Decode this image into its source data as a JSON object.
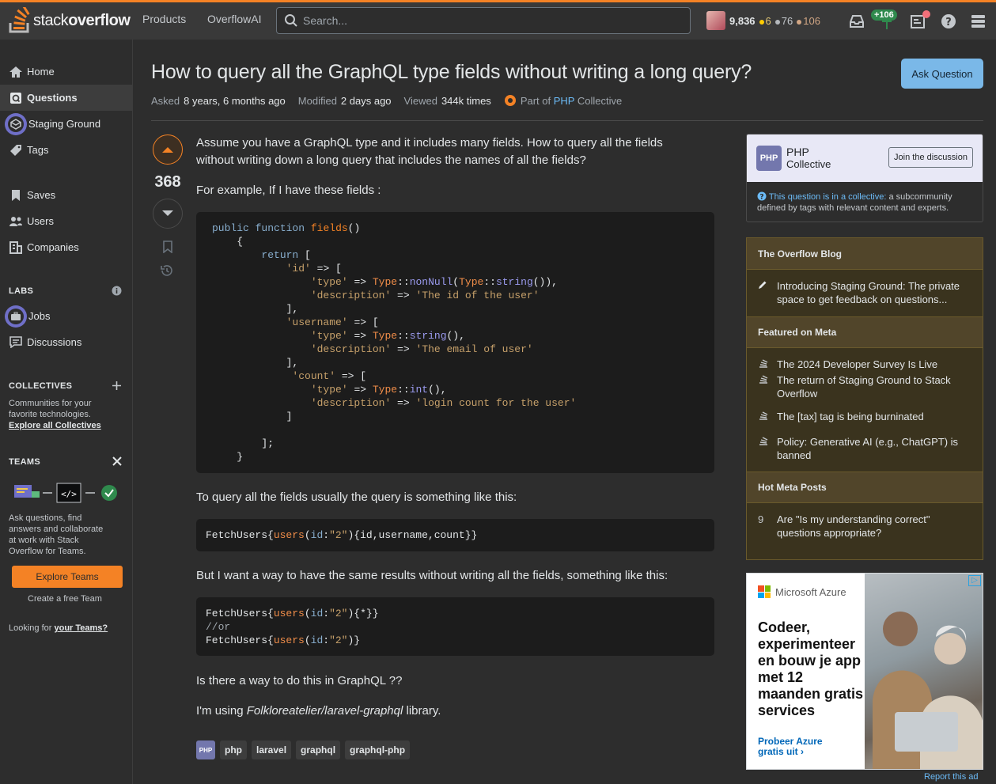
{
  "topbar": {
    "logo_light": "stack",
    "logo_bold": "overflow",
    "nav": [
      "Products",
      "OverflowAI"
    ],
    "search_placeholder": "Search...",
    "reputation": "9,836",
    "gold": "6",
    "silver": "76",
    "bronze": "106",
    "achievement": "+106"
  },
  "sidebar": {
    "items": [
      "Home",
      "Questions",
      "Staging Ground",
      "Tags",
      "Saves",
      "Users",
      "Companies"
    ],
    "labs_heading": "LABS",
    "labs_items": [
      "Jobs",
      "Discussions"
    ],
    "collectives_heading": "COLLECTIVES",
    "collectives_desc_1": "Communities for your",
    "collectives_desc_2": "favorite technologies.",
    "collectives_link": "Explore all Collectives",
    "teams_heading": "TEAMS",
    "teams_desc": [
      "Ask questions, find",
      "answers and collaborate",
      "at work with Stack",
      "Overflow for Teams."
    ],
    "explore_teams": "Explore Teams",
    "create_team": "Create a free Team",
    "looking_prefix": "Looking for ",
    "looking_link": "your Teams?"
  },
  "question": {
    "title": "How to query all the GraphQL type fields without writing a long query?",
    "ask_button": "Ask Question",
    "asked_label": "Asked",
    "asked_value": "8 years, 6 months ago",
    "modified_label": "Modified",
    "modified_value": "2 days ago",
    "viewed_label": "Viewed",
    "viewed_value": "344k times",
    "collective_prefix": "Part of ",
    "collective_name": "PHP",
    "collective_suffix": " Collective",
    "score": "368",
    "para1": "Assume you have a GraphQL type and it includes many fields. How to query all the fields without writing down a long query that includes the names of all the fields?",
    "para2": "For example, If I have these fields :",
    "para3": "To query all the fields usually the query is something like this:",
    "para4": "But I want a way to have the same results without writing all the fields, something like this:",
    "para5": "Is there a way to do this in GraphQL ??",
    "para6_prefix": "I'm using ",
    "para6_em": "Folkloreatelier/laravel-graphql",
    "para6_suffix": " library.",
    "tags": [
      "php",
      "laravel",
      "graphql",
      "graphql-php"
    ],
    "php_badge": "PHP"
  },
  "collective_card": {
    "logo": "PHP",
    "name": "PHP",
    "sub": "Collective",
    "join": "Join the discussion",
    "desc_link": "This question is in a collective:",
    "desc_rest": " a subcommunity defined by tags with relevant content and experts."
  },
  "blog": {
    "title": "The Overflow Blog",
    "items": [
      "Introducing Staging Ground: The private space to get feedback on questions..."
    ],
    "meta_title": "Featured on Meta",
    "meta_items": [
      "The 2024 Developer Survey Is Live",
      "The return of Staging Ground to Stack Overflow",
      "The [tax] tag is being burninated",
      "Policy: Generative AI (e.g., ChatGPT) is banned"
    ],
    "hot_title": "Hot Meta Posts",
    "hot_count": "9",
    "hot_items": [
      "Are \"Is my understanding correct\" questions appropriate?"
    ]
  },
  "ad": {
    "brand": "Microsoft Azure",
    "headline": "Codeer, experimenteer en bouw je app met 12 maanden gratis services",
    "cta": "Probeer Azure gratis uit ›",
    "report": "Report this ad"
  },
  "colors": {
    "accent": "#f48225",
    "link": "#6cbbf7",
    "collective": "#7377ad"
  }
}
